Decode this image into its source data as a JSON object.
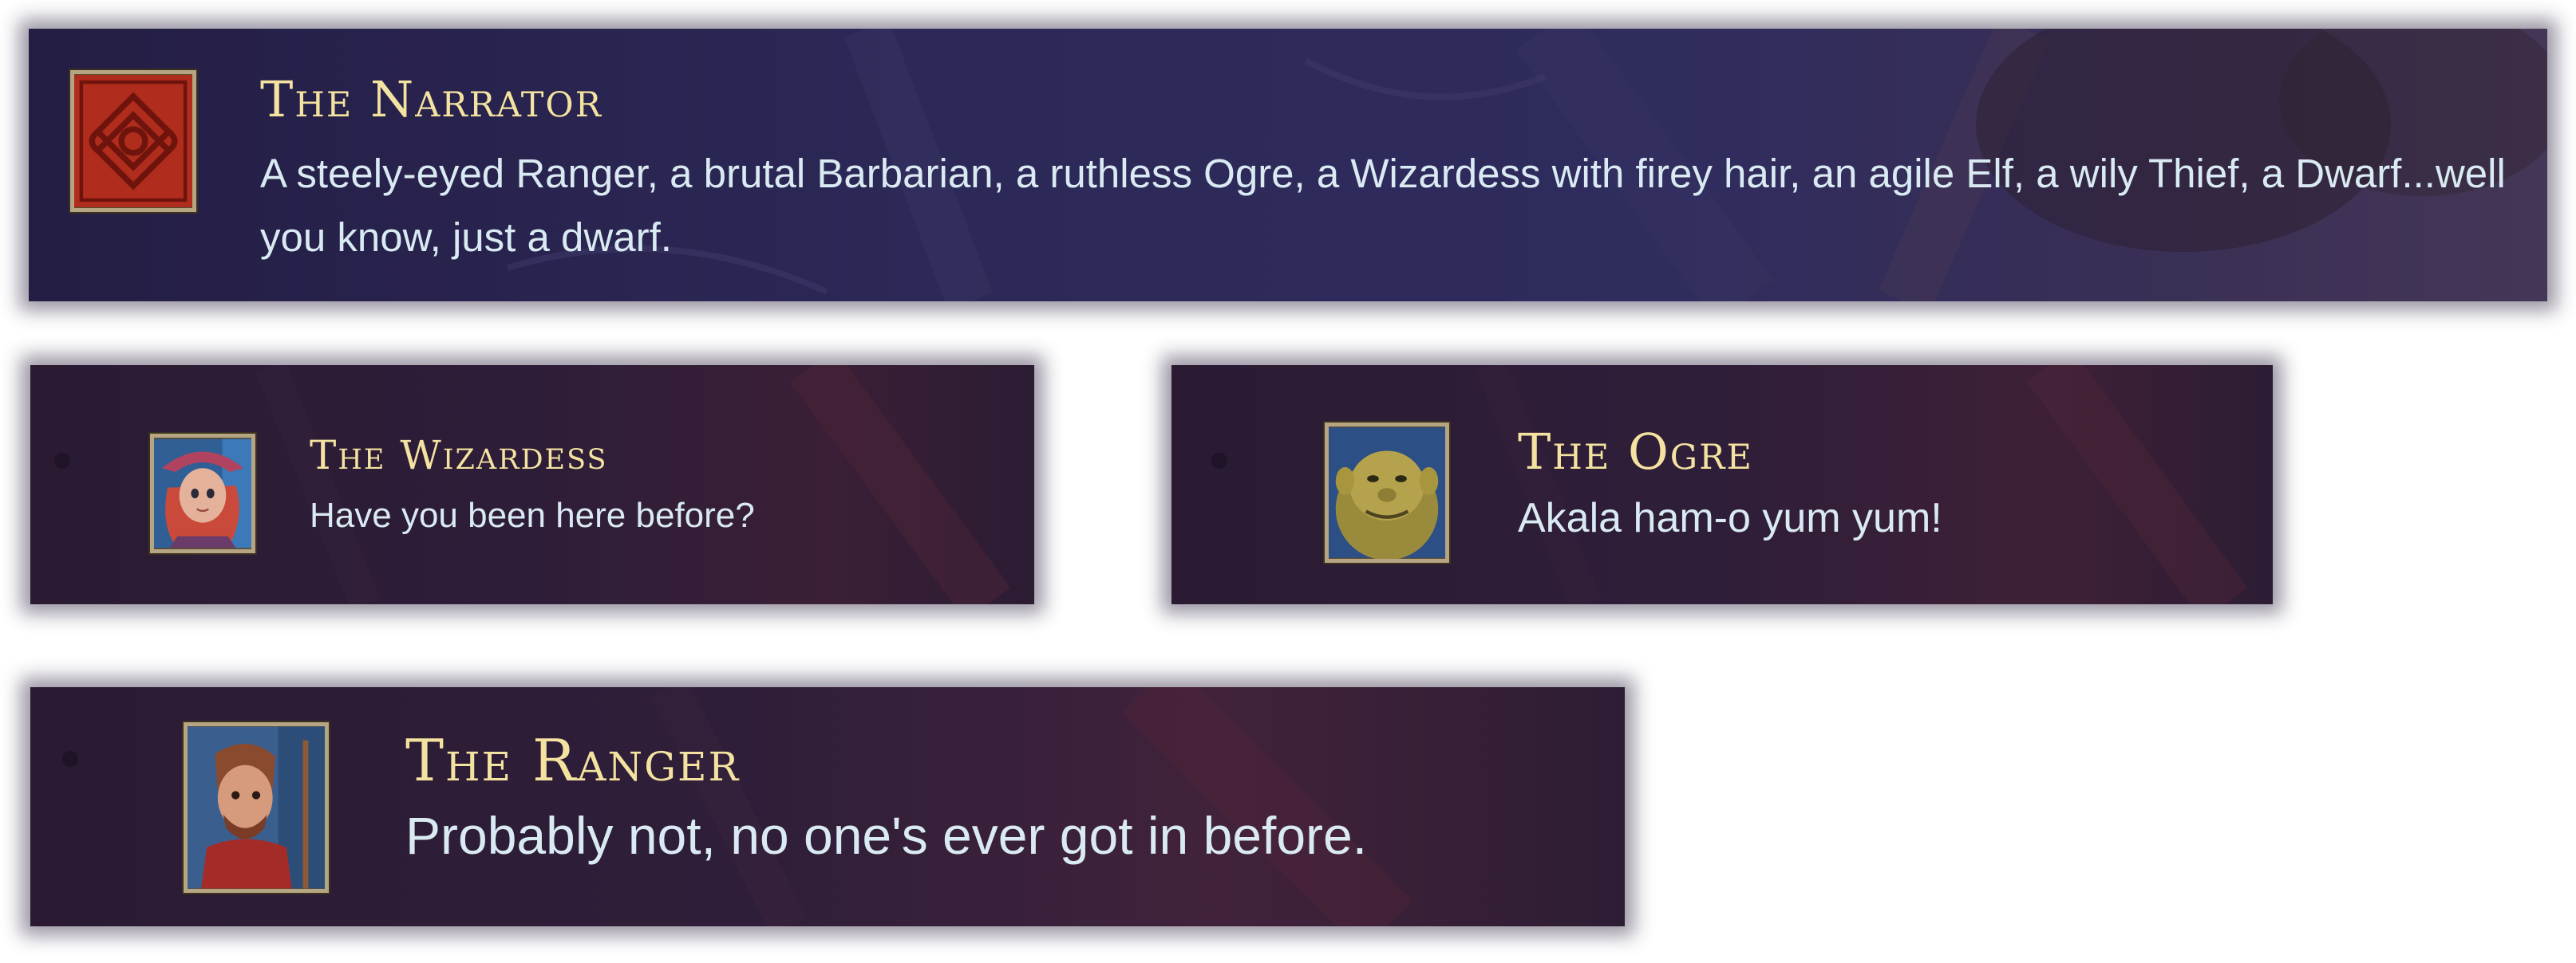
{
  "dialogues": [
    {
      "speaker": "The Narrator",
      "text": "A steely-eyed Ranger, a brutal Barbarian, a ruthless Ogre, a Wizardess with firey hair, an agile Elf, a wily Thief, a Dwarf...well you know, just a dwarf.",
      "portrait_icon": "celtic-knot-emblem-icon"
    },
    {
      "speaker": "The Wizardess",
      "text": "Have you been here before?",
      "portrait_icon": "wizardess-portrait"
    },
    {
      "speaker": "The Ogre",
      "text": "Akala ham-o yum yum!",
      "portrait_icon": "ogre-portrait"
    },
    {
      "speaker": "The Ranger",
      "text": "Probably not, no one's ever got in before.",
      "portrait_icon": "ranger-portrait"
    }
  ],
  "colors": {
    "speaker_name": "#f4e3a0",
    "dialogue_text": "#d9eaf2",
    "portrait_frame": "#b6a582"
  }
}
